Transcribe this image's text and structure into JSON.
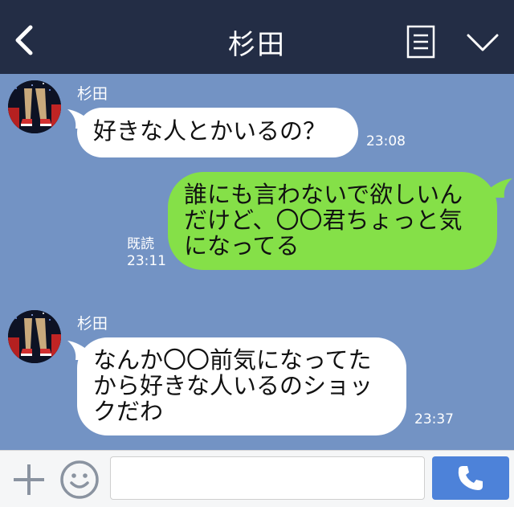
{
  "header": {
    "title": "杉田"
  },
  "messages": [
    {
      "sender": "杉田",
      "text": "好きな人とかいるの？",
      "time": "23:08"
    },
    {
      "lines": [
        "誰にも言わないで欲しいん",
        "だけど、〇〇君ちょっと気",
        "になってる"
      ],
      "read_label": "既読",
      "time": "23:11"
    },
    {
      "sender": "杉田",
      "lines": [
        "なんか〇〇前気になってた",
        "から好きな人いるのショッ",
        "クだわ"
      ],
      "time": "23:37"
    }
  ],
  "footer": {
    "input_value": "",
    "icons": [
      "plus-icon",
      "emoji-icon",
      "phone-icon"
    ]
  },
  "colors": {
    "header_bg": "#232d45",
    "chat_bg": "#7393c4",
    "outgoing_bubble": "#85e048",
    "incoming_bubble": "#ffffff",
    "call_button": "#4d82d9"
  }
}
